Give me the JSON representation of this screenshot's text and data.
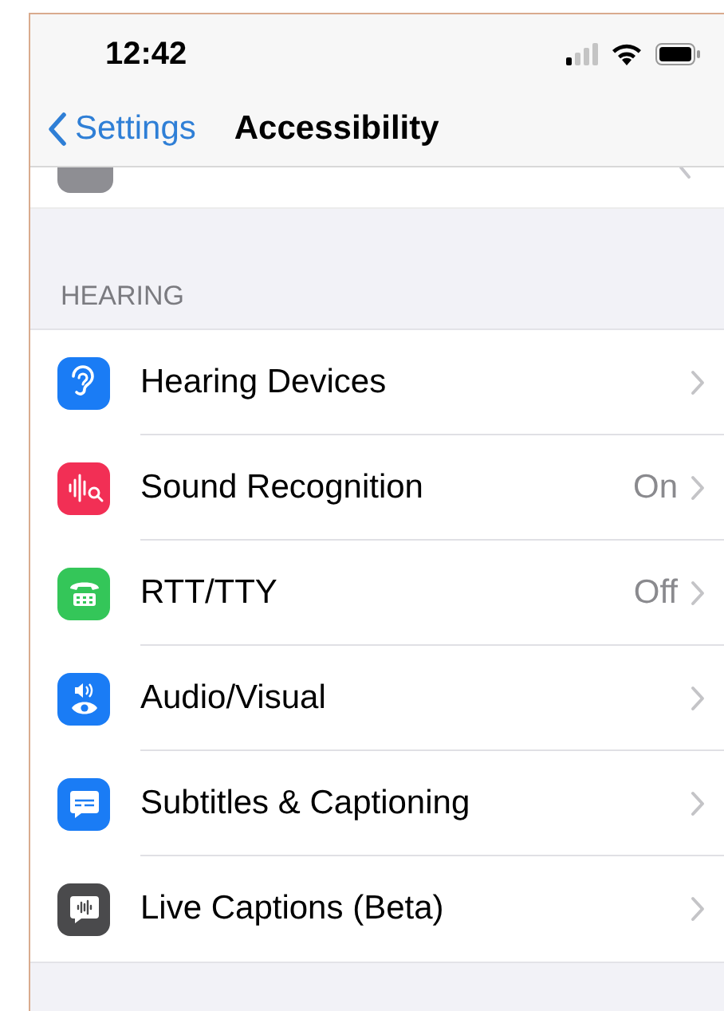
{
  "status_bar": {
    "time": "12:42"
  },
  "nav": {
    "back": "Settings",
    "title": "Accessibility"
  },
  "section": {
    "header": "HEARING",
    "rows": [
      {
        "label": "Hearing Devices",
        "color": "#1a7cf5"
      },
      {
        "label": "Sound Recognition",
        "value": "On",
        "color": "#f22f55"
      },
      {
        "label": "RTT/TTY",
        "value": "Off",
        "color": "#34c659"
      },
      {
        "label": "Audio/Visual",
        "color": "#1a7cf5"
      },
      {
        "label": "Subtitles & Captioning",
        "color": "#1a7cf5"
      },
      {
        "label": "Live Captions (Beta)",
        "color": "#4a4a4c"
      }
    ]
  }
}
